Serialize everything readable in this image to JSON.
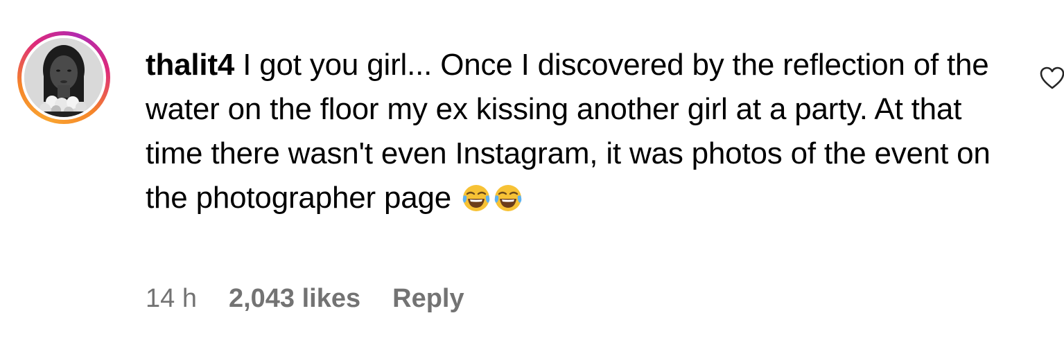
{
  "comment": {
    "username": "thalit4",
    "text": "I got you girl... Once I discovered by the reflection of the water on the floor my ex kissing another girl at a party. At that time there wasn't even Instagram, it was photos of the event on the photographer page",
    "emojis": [
      "face-with-tears-of-joy",
      "face-with-tears-of-joy"
    ],
    "time": "14 h",
    "likes": "2,043 likes",
    "reply_label": "Reply",
    "like_icon": "heart-outline-icon"
  },
  "colors": {
    "text": "#000000",
    "meta": "#737373",
    "ring_start": "#f9a431",
    "ring_end": "#b12ab0"
  }
}
